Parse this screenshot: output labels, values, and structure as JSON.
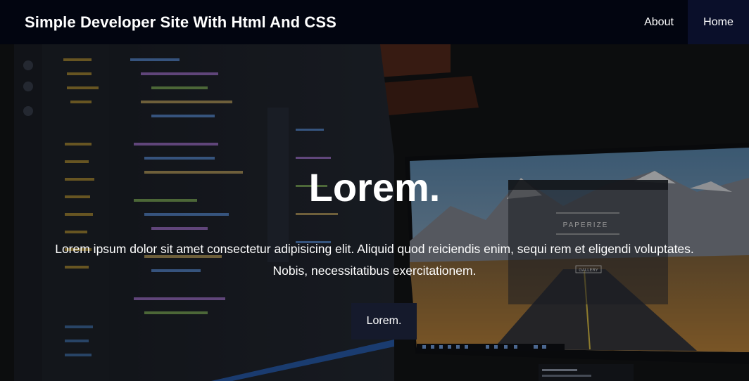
{
  "header": {
    "brand": "Simple Developer Site With Html And CSS",
    "nav": {
      "about": "About",
      "home": "Home"
    }
  },
  "hero": {
    "title": "Lorem.",
    "text_line1": "Lorem ipsum dolor sit amet consectetur adipisicing elit. Aliquid quod reiciendis enim, sequi rem et eligendi voluptates.",
    "text_line2": "Nobis, necessitatibus exercitationem.",
    "button_label": "Lorem.",
    "monitor_app_title": "PAPERIZE",
    "monitor_app_button": "GALLERY"
  },
  "colors": {
    "header_bg": "#020510",
    "nav_active_bg": "#0a0f2a",
    "button_bg": "#151a2c"
  }
}
